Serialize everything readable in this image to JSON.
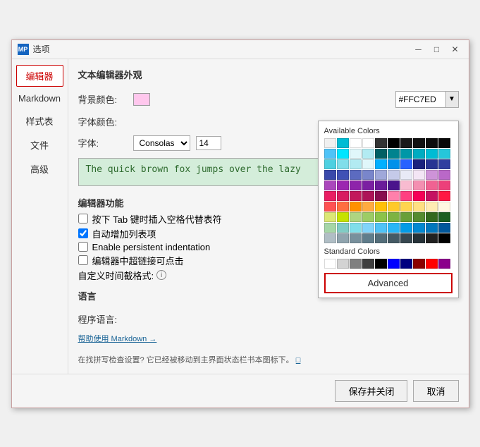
{
  "window": {
    "icon_text": "MP",
    "title": "选项",
    "minimize_label": "─",
    "maximize_label": "□",
    "close_label": "✕"
  },
  "sidebar": {
    "items": [
      {
        "label": "编辑器",
        "active": true
      },
      {
        "label": "Markdown"
      },
      {
        "label": "样式表"
      },
      {
        "label": "文件"
      },
      {
        "label": "高级"
      }
    ]
  },
  "main": {
    "section_title": "文本编辑器外观",
    "bg_color_label": "背景颜色:",
    "bg_color_value": "#FFC7ED",
    "available_colors_title": "Available Colors",
    "font_color_label": "字体颜色:",
    "font_label": "字体:",
    "font_value": "Consolas",
    "font_size_value": "14",
    "preview_text": "The quick brown fox jumps over the lazy",
    "editor_features_title": "编辑器功能",
    "cb1_label": "按下 Tab 键时插入空格代替表符",
    "cb2_label": "自动增加列表项",
    "cb3_label": "Enable persistent indentation",
    "cb4_label": "编辑器中超链接可点击",
    "custom_format_label": "自定义时间截格式:",
    "lang_title": "语言",
    "lang_label": "程序语言:",
    "help_link": "帮助使用 Markdown →",
    "move_notice": "在找拼写检查设置? 它已经被移动到主界面状态栏书本图标下。",
    "move_link": "□"
  },
  "color_picker": {
    "available_title": "Available Colors",
    "standard_title": "Standard Colors",
    "advanced_label": "Advanced",
    "available_colors": [
      "#f0f0f0",
      "#00bcd4",
      "#ffffff",
      "#ffffff",
      "#333333",
      "#000000",
      "#1a1a1a",
      "#111111",
      "#0d0d0d",
      "#080808",
      "#4fc3f7",
      "#00e5ff",
      "#e0f7fa",
      "#b2ebf2",
      "#006064",
      "#00838f",
      "#0097a7",
      "#00acc1",
      "#00bcd4",
      "#26c6da",
      "#4dd0e1",
      "#80deea",
      "#b2ebf2",
      "#e0f7fa",
      "#00b0ff",
      "#0091ea",
      "#2962ff",
      "#1a237e",
      "#283593",
      "#303f9f",
      "#3949ab",
      "#3f51b5",
      "#5c6bc0",
      "#7986cb",
      "#9fa8da",
      "#c5cae9",
      "#e8eaf6",
      "#f3e5f5",
      "#ce93d8",
      "#ba68c8",
      "#ab47bc",
      "#9c27b0",
      "#8e24aa",
      "#7b1fa2",
      "#6a1b9a",
      "#4a148c",
      "#f8bbd0",
      "#f48fb1",
      "#f06292",
      "#ec407a",
      "#e91e63",
      "#d81b60",
      "#c2185b",
      "#ad1457",
      "#880e4f",
      "#ff80ab",
      "#ff4081",
      "#f50057",
      "#c51162",
      "#ff1744",
      "#ff5252",
      "#ff6e40",
      "#ff9100",
      "#ffab40",
      "#ffc107",
      "#ffca28",
      "#ffd54f",
      "#ffe082",
      "#ffecb3",
      "#fff8e1",
      "#dce775",
      "#c6e200",
      "#aed581",
      "#9ccc65",
      "#8bc34a",
      "#7cb342",
      "#689f38",
      "#558b2f",
      "#33691e",
      "#1b5e20",
      "#a5d6a7",
      "#80cbc4",
      "#80deea",
      "#81d4fa",
      "#4fc3f7",
      "#29b6f6",
      "#039be5",
      "#0288d1",
      "#0277bd",
      "#01579b",
      "#b0bec5",
      "#90a4ae",
      "#78909c",
      "#607d8b",
      "#546e7a",
      "#455a64",
      "#37474f",
      "#263238",
      "#212121",
      "#000000"
    ],
    "standard_colors": [
      "#ffffff",
      "#d3d3d3",
      "#808080",
      "#404040",
      "#000000",
      "#0000ff",
      "#000080",
      "#8b0000",
      "#ff0000",
      "#8b008b"
    ]
  },
  "footer": {
    "save_label": "保存并关闭",
    "cancel_label": "取消"
  }
}
